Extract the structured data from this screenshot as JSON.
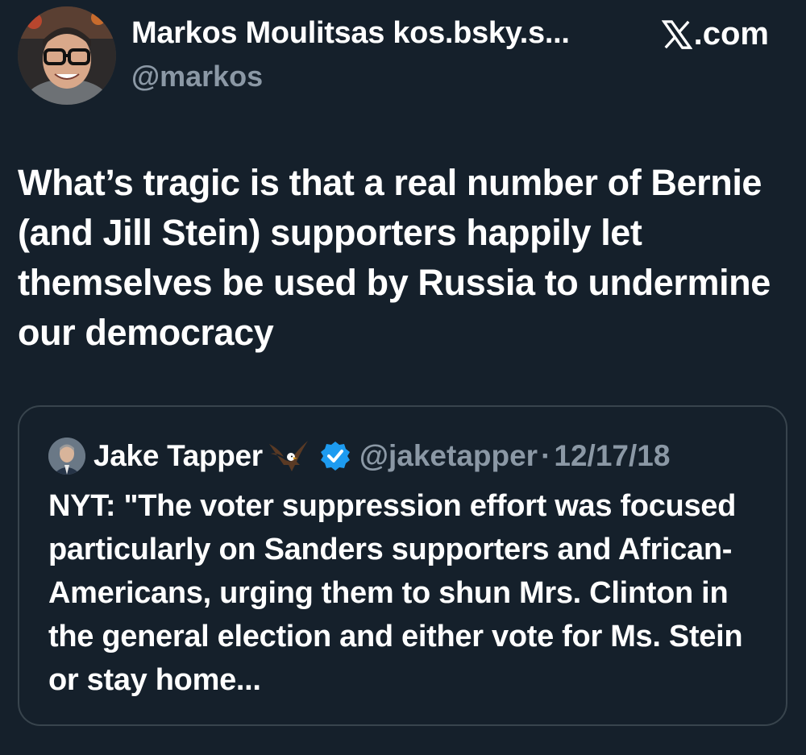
{
  "post": {
    "author": {
      "display_name": "Markos Moulitsas kos.bsky.s...",
      "handle": "@markos",
      "avatar_icon": "person-with-glasses-avatar"
    },
    "source": {
      "label": ".com",
      "icon": "x-logo-icon"
    },
    "text": "What’s tragic is that a real number of Bernie (and Jill Stein) supporters happily let themselves be used by Russia to undermine our democracy"
  },
  "quote": {
    "author": {
      "display_name": "Jake Tapper",
      "handle": "@jaketapper",
      "emoji_icon": "eagle-icon",
      "verified_icon": "verified-badge-icon",
      "avatar_icon": "person-in-suit-avatar"
    },
    "separator": "·",
    "date": "12/17/18",
    "text": "NYT: \"The voter suppression effort was focused particularly on Sanders supporters and African-Americans, urging them to shun Mrs. Clinton in the general election and either vote for Ms. Stein or stay home..."
  },
  "colors": {
    "background": "#15202b",
    "primary_text": "#ffffff",
    "secondary_text": "#8b98a5",
    "border": "#38444d",
    "verified": "#1d9bf0"
  }
}
